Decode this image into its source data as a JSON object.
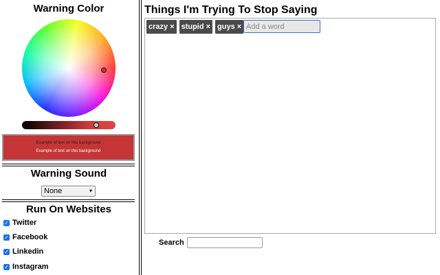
{
  "warning_color": {
    "title": "Warning Color",
    "selected_color": "#c83232",
    "preview_dark_text": "Example of text on this background",
    "preview_light_text": "Example of text on this background"
  },
  "warning_sound": {
    "title": "Warning Sound",
    "selected": "None"
  },
  "run_on_websites": {
    "title": "Run On Websites",
    "sites": [
      {
        "label": "Twitter",
        "checked": true
      },
      {
        "label": "Facebook",
        "checked": true
      },
      {
        "label": "Linkedin",
        "checked": true
      },
      {
        "label": "Instagram",
        "checked": true
      }
    ]
  },
  "main": {
    "title": "Things I'm Trying To Stop Saying",
    "tags": [
      {
        "label": "crazy"
      },
      {
        "label": "stupid"
      },
      {
        "label": "guys"
      }
    ],
    "remove_glyph": "×",
    "add_placeholder": "Add a word",
    "search_label": "Search",
    "search_value": ""
  },
  "icons": {
    "checkbox": "checkbox-checked-icon",
    "dropdown": "chevron-down-icon",
    "remove": "close-icon"
  },
  "check_glyph": "✓",
  "caret_glyph": "▾"
}
